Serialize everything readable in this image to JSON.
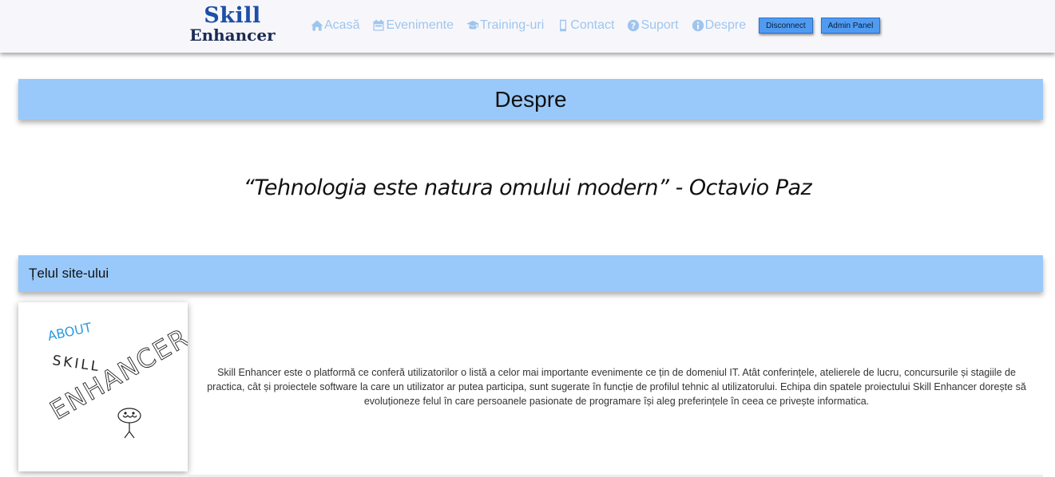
{
  "logo": {
    "line1": "Skill",
    "line2": "Enhancer"
  },
  "nav": {
    "items": [
      {
        "icon": "home-icon",
        "label": "Acasă"
      },
      {
        "icon": "calendar-icon",
        "label": "Evenimente"
      },
      {
        "icon": "graduation-cap-icon",
        "label": "Training-uri"
      },
      {
        "icon": "mobile-phone-icon",
        "label": "Contact"
      },
      {
        "icon": "question-circle-icon",
        "label": "Suport"
      },
      {
        "icon": "info-circle-icon",
        "label": "Despre"
      }
    ],
    "disconnect_label": "Disconnect",
    "admin_label": "Admin Panel"
  },
  "page": {
    "title": "Despre",
    "quote": "“Tehnologia este natura omului modern” - Octavio Paz",
    "section_title": "Țelul site-ului",
    "image_text": {
      "about": "ABOUT",
      "skill": "SKILL",
      "enhancer": "ENHANCER"
    },
    "description": "Skill Enhancer este o platformă ce conferă utilizatorilor o listă a celor mai importante evenimente ce țin de domeniul IT. Atât conferințele, atelierele de lucru, concursurile și stagiile de practica, cât și proiectele software la care un utilizator ar putea participa, sunt sugerate în funcție de profilul tehnic al utilizatorului. Echipa din spatele proiectului Skill Enhancer dorește să evoluționeze felul în care persoanele pasionate de programare își aleg preferințele în ceea ce privește informatica."
  },
  "colors": {
    "nav_link": "#9fc5ee",
    "banner": "#99c9fb",
    "button": "#4f9bf2",
    "logo_primary": "#1c4fa8",
    "logo_secondary": "#1b2a55"
  }
}
